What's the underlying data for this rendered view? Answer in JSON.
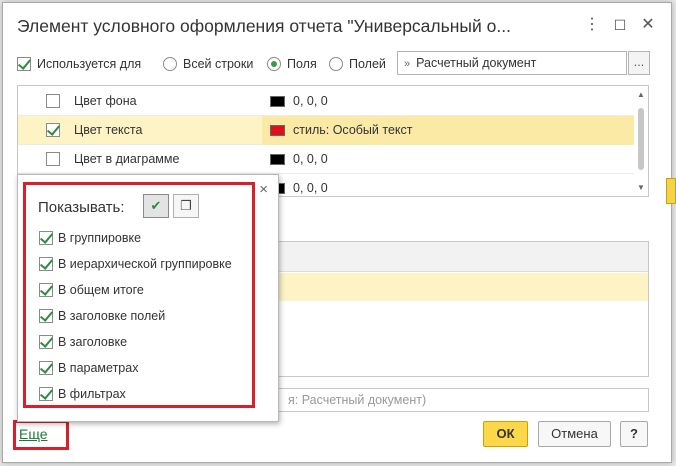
{
  "dialog": {
    "title": "Элемент условного оформления отчета \"Универсальный о...",
    "controls": {
      "menu": "⋮",
      "maximize": "☐",
      "close": "✕"
    }
  },
  "toolbar": {
    "used_for_label": "Используется для",
    "radio_options": [
      "Всей строки",
      "Поля",
      "Полей"
    ],
    "selected_radio": "Поля",
    "field_value": "Расчетный документ",
    "field_chevron": "»",
    "ellipsis_button": "..."
  },
  "appearance_table": {
    "rows": [
      {
        "label": "Цвет фона",
        "checked": false,
        "value": "0, 0, 0",
        "swatch_color": "#000000"
      },
      {
        "label": "Цвет текста",
        "checked": true,
        "value": "стиль: Особый текст",
        "swatch_color": "#e0101a"
      },
      {
        "label": "Цвет в диаграмме",
        "checked": false,
        "value": "0, 0, 0",
        "swatch_color": "#000000"
      },
      {
        "label": "",
        "checked": false,
        "value": "0, 0, 0",
        "swatch_color": "#000000"
      }
    ],
    "scroll": {
      "up": "▲",
      "down": "▼"
    }
  },
  "lower": {
    "field_hint": "я: Расчетный документ)"
  },
  "popup": {
    "show_label": "Показывать:",
    "close": "×",
    "buttons": {
      "check_all": "✔",
      "copy": "❐"
    },
    "items": [
      {
        "label": "В группировке",
        "checked": true
      },
      {
        "label": "В иерархической группировке",
        "checked": true
      },
      {
        "label": "В общем итоге",
        "checked": true
      },
      {
        "label": "В заголовке полей",
        "checked": true
      },
      {
        "label": "В заголовке",
        "checked": true
      },
      {
        "label": "В параметрах",
        "checked": true
      },
      {
        "label": "В фильтрах",
        "checked": true
      }
    ]
  },
  "footer": {
    "more_link": "Еще",
    "ok": "ОК",
    "cancel": "Отмена",
    "help": "?"
  },
  "colors": {
    "accent_green": "#2e8b3e",
    "highlight_red": "#d8202a",
    "ok_yellow": "#fbd84a"
  }
}
